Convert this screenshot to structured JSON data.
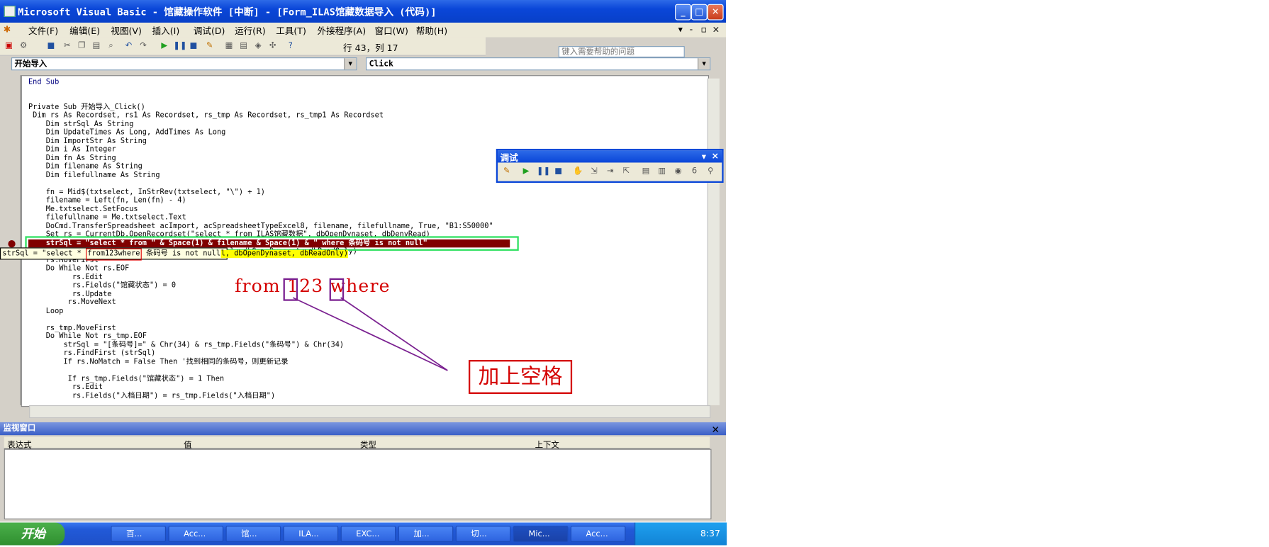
{
  "window": {
    "title": "Microsoft Visual Basic - 馆藏操作软件 [中断] - [Form_ILAS馆藏数据导入 (代码)]",
    "min": "_",
    "max": "□",
    "close": "✕"
  },
  "menubar": {
    "items": [
      "文件(F)",
      "编辑(E)",
      "视图(V)",
      "插入(I)",
      "调试(D)",
      "运行(R)",
      "工具(T)",
      "外接程序(A)",
      "窗口(W)",
      "帮助(H)"
    ],
    "help_placeholder": "键入需要帮助的问题"
  },
  "toolbar": {
    "position_text": "行 43，列 17"
  },
  "combos": {
    "object": "开始导入",
    "procedure": "Click"
  },
  "code_lines": [
    "End Sub",
    "",
    "",
    "Private Sub 开始导入_Click()",
    " Dim rs As Recordset, rs1 As Recordset, rs_tmp As Recordset, rs_tmp1 As Recordset",
    "    Dim strSql As String",
    "    Dim UpdateTimes As Long, AddTimes As Long",
    "    Dim ImportStr As String",
    "    Dim i As Integer",
    "    Dim fn As String",
    "    Dim filename As String",
    "    Dim filefullname As String",
    "",
    "    fn = Mid$(txtselect, InStrRev(txtselect, \"\\\") + 1)",
    "    filename = Left(fn, Len(fn) - 4)",
    "    Me.txtselect.SetFocus",
    "    filefullname = Me.txtselect.Text",
    "    DoCmd.TransferSpreadsheet acImport, acSpreadsheetTypeExcel8, filename, filefullname, True, \"B1:S50000\"",
    "    Set rs = CurrentDb.OpenRecordset(\"select * from ILAS馆藏数据\", dbOpenDynaset, dbDenyRead)",
    "    strSql = \"select * from \" & Space(1) & filename & Space(1) & \" where 条码号 is not null\"",
    "    Set rs_tmp = CurrentDb.OpenRecordset(strSql, dbOpenDynaset, dbReadOnly)",
    "    rs.MoveFirst",
    "    Do While Not rs.EOF",
    "          rs.Edit",
    "          rs.Fields(\"馆藏状态\") = 0",
    "          rs.Update",
    "         rs.MoveNext",
    "    Loop",
    "",
    "    rs_tmp.MoveFirst",
    "    Do While Not rs_tmp.EOF",
    "        strSql = \"[条码号]=\" & Chr(34) & rs_tmp.Fields(\"条码号\") & Chr(34)",
    "        rs.FindFirst (strSql)",
    "        If rs.NoMatch = False Then '找到相同的条码号，则更新记录",
    "",
    "         If rs_tmp.Fields(\"馆藏状态\") = 1 Then",
    "          rs.Edit",
    "          rs.Fields(\"入档日期\") = rs_tmp.Fields(\"入档日期\")"
  ],
  "tooltip": {
    "prefix": "strSql = \"select * ",
    "boxed": "from123where",
    "suffix": " 条码号 is not null\"",
    "partial_right": "l, dbOpenDynaset, dbReadOnly)"
  },
  "debug_toolbar": {
    "title": "调试"
  },
  "watch": {
    "title": "监视窗口",
    "columns": [
      "表达式",
      "值",
      "类型",
      "上下文"
    ]
  },
  "annotation": {
    "red_text": "from 123 where",
    "callout": "加上空格"
  },
  "taskbar": {
    "start": "开始",
    "buttons": [
      "百...",
      "Acc...",
      "馆...",
      "ILA...",
      "EXC...",
      "加...",
      "切...",
      "Mic...",
      "Acc..."
    ],
    "active_index": 7,
    "clock": "8:37"
  }
}
